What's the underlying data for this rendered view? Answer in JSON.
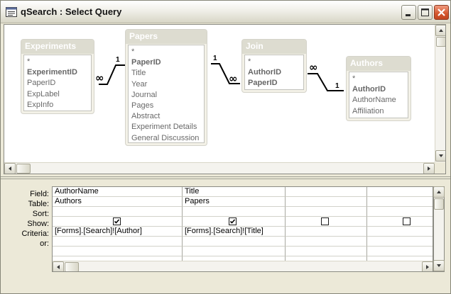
{
  "window": {
    "title": "qSearch : Select Query"
  },
  "tables": [
    {
      "name": "Experiments",
      "fields": [
        {
          "label": "*",
          "pk": false
        },
        {
          "label": "ExperimentID",
          "pk": true
        },
        {
          "label": "PaperID",
          "pk": false
        },
        {
          "label": "ExpLabel",
          "pk": false
        },
        {
          "label": "ExpInfo",
          "pk": false
        }
      ]
    },
    {
      "name": "Papers",
      "fields": [
        {
          "label": "*",
          "pk": false
        },
        {
          "label": "PaperID",
          "pk": true
        },
        {
          "label": "Title",
          "pk": false
        },
        {
          "label": "Year",
          "pk": false
        },
        {
          "label": "Journal",
          "pk": false
        },
        {
          "label": "Pages",
          "pk": false
        },
        {
          "label": "Abstract",
          "pk": false
        },
        {
          "label": "Experiment Details",
          "pk": false
        },
        {
          "label": "General Discussion",
          "pk": false
        }
      ]
    },
    {
      "name": "Join",
      "fields": [
        {
          "label": "*",
          "pk": false
        },
        {
          "label": "AuthorID",
          "pk": true
        },
        {
          "label": "PaperID",
          "pk": true
        }
      ]
    },
    {
      "name": "Authors",
      "fields": [
        {
          "label": "*",
          "pk": false
        },
        {
          "label": "AuthorID",
          "pk": true
        },
        {
          "label": "AuthorName",
          "pk": false
        },
        {
          "label": "Affiliation",
          "pk": false
        }
      ]
    }
  ],
  "relationships": [
    {
      "one_label": "1",
      "many_label": "∞"
    },
    {
      "one_label": "1",
      "many_label": "∞"
    },
    {
      "one_label": "1",
      "many_label": "∞"
    }
  ],
  "grid": {
    "row_labels": [
      "Field:",
      "Table:",
      "Sort:",
      "Show:",
      "Criteria:",
      "or:"
    ],
    "columns": [
      {
        "field": "AuthorName",
        "table": "Authors",
        "sort": "",
        "show": true,
        "criteria": "[Forms].[Search]![Author]",
        "or": ""
      },
      {
        "field": "Title",
        "table": "Papers",
        "sort": "",
        "show": true,
        "criteria": "[Forms].[Search]![Title]",
        "or": ""
      },
      {
        "field": "",
        "table": "",
        "sort": "",
        "show": false,
        "criteria": "",
        "or": ""
      },
      {
        "field": "",
        "table": "",
        "sort": "",
        "show": false,
        "criteria": "",
        "or": ""
      }
    ]
  },
  "colors": {
    "title_text": "#141414",
    "field_list_header": "#c7c5b2",
    "window_bg": "#ece9d8",
    "close_button": "#d4552c"
  },
  "icons": [
    "query-window-icon",
    "minimize-icon",
    "maximize-icon",
    "close-icon",
    "scroll-up-icon",
    "scroll-down-icon",
    "scroll-left-icon",
    "scroll-right-icon",
    "checkmark-icon"
  ]
}
